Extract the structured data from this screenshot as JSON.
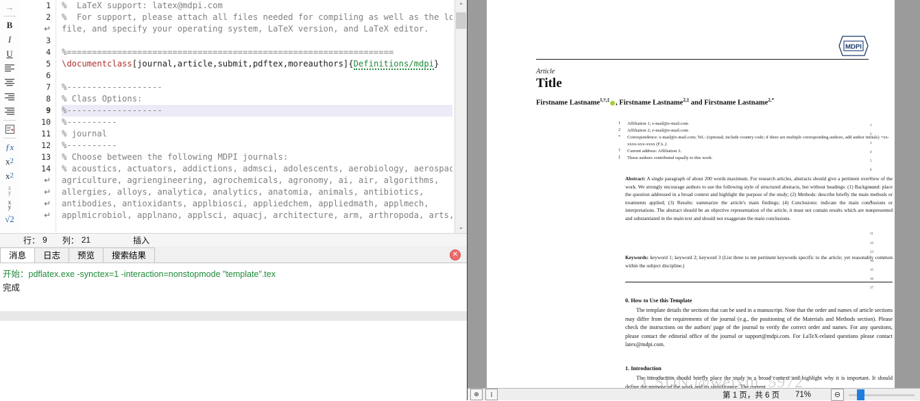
{
  "editor": {
    "format_toolbar": [
      {
        "name": "indent-arrow-icon",
        "glyph": "→"
      },
      {
        "name": "bold-icon",
        "glyph": "B"
      },
      {
        "name": "italic-icon",
        "glyph": "I"
      },
      {
        "name": "underline-icon",
        "glyph": "U"
      },
      {
        "name": "align-left-icon",
        "glyph": "≡"
      },
      {
        "name": "align-center-icon",
        "glyph": "≡"
      },
      {
        "name": "align-right-icon",
        "glyph": "≡"
      },
      {
        "name": "align-justify-icon",
        "glyph": "≡"
      },
      {
        "name": "insert-note-icon",
        "glyph": "▤"
      },
      {
        "name": "function-icon",
        "glyph": "ƒx"
      },
      {
        "name": "subscript-icon",
        "glyph": "x₂"
      },
      {
        "name": "superscript-icon",
        "glyph": "x²"
      },
      {
        "name": "inline-fraction-icon",
        "glyph": "x/y"
      },
      {
        "name": "display-fraction-icon",
        "glyph": "x/y"
      },
      {
        "name": "sqrt-icon",
        "glyph": "√2"
      }
    ],
    "gutter": [
      "1",
      "2",
      "↵",
      "3",
      "4",
      "5",
      "6",
      "7",
      "8",
      "9",
      "10",
      "11",
      "12",
      "13",
      "14",
      "↵",
      "↵",
      "↵",
      "↵"
    ],
    "current_line_index": 11,
    "lines": [
      {
        "gutter": "1",
        "text": "%  LaTeX support: latex@mdpi.com",
        "style": "comment"
      },
      {
        "gutter": "2",
        "text": "%  For support, please attach all files needed for compiling as well as the log",
        "style": "comment"
      },
      {
        "gutter": "↵",
        "text": "file, and specify your operating system, LaTeX version, and LaTeX editor.",
        "style": "comment"
      },
      {
        "gutter": "3",
        "text": "",
        "style": "comment"
      },
      {
        "gutter": "4",
        "text": "%=================================================================",
        "style": "comment"
      },
      {
        "gutter": "5",
        "text": "\\documentclass[journal,article,submit,pdftex,moreauthors]{Definitions/mdpi}",
        "style": "code"
      },
      {
        "gutter": "6",
        "text": "",
        "style": "comment"
      },
      {
        "gutter": "7",
        "text": "%-------------------",
        "style": "comment"
      },
      {
        "gutter": "8",
        "text": "% Class Options:",
        "style": "comment"
      },
      {
        "gutter": "9",
        "text": "%-------------------",
        "style": "comment",
        "highlight": true
      },
      {
        "gutter": "10",
        "text": "%----------",
        "style": "comment"
      },
      {
        "gutter": "11",
        "text": "% journal",
        "style": "comment"
      },
      {
        "gutter": "12",
        "text": "%----------",
        "style": "comment"
      },
      {
        "gutter": "13",
        "text": "% Choose between the following MDPI journals:",
        "style": "comment"
      },
      {
        "gutter": "14",
        "text": "% acoustics, actuators, addictions, admsci, adolescents, aerobiology, aerospace,",
        "style": "comment"
      },
      {
        "gutter": "↵",
        "text": "agriculture, agriengineering, agrochemicals, agronomy, ai, air, algorithms,",
        "style": "comment"
      },
      {
        "gutter": "↵",
        "text": "allergies, alloys, analytica, analytics, anatomia, animals, antibiotics,",
        "style": "comment"
      },
      {
        "gutter": "↵",
        "text": "antibodies, antioxidants, applbiosci, appliedchem, appliedmath, applmech,",
        "style": "comment"
      },
      {
        "gutter": "↵",
        "text": "applmicrobiol, applnano, applsci, aquacj, architecture, arm, arthropoda, arts,",
        "style": "comment"
      }
    ],
    "documentclass_line": {
      "command": "\\documentclass",
      "options": "[journal,article,submit,pdftex,moreauthors]{",
      "spellchecked": "Definitions/mdpi",
      "close": "}"
    },
    "status_bar": {
      "row_label": "行：",
      "row_value": "9",
      "col_label": "列：",
      "col_value": "21",
      "mode": "插入"
    },
    "scrollbar": {
      "up": "⌃",
      "down": "⌄"
    }
  },
  "output_panel": {
    "tabs": [
      {
        "label": "消息",
        "active": true
      },
      {
        "label": "日志",
        "active": false
      },
      {
        "label": "预览",
        "active": false
      },
      {
        "label": "搜索结果",
        "active": false
      }
    ],
    "close_icon": "✕",
    "messages": [
      {
        "text": "开始：pdflatex.exe -synctex=1 -interaction=nonstopmode \"template\".tex",
        "color": "green"
      },
      {
        "text": "完成",
        "color": "black"
      }
    ]
  },
  "pdf": {
    "logo_text": "MDPI",
    "article_label": "Article",
    "title": "Title",
    "authors_prefix": "Firstname Lastname",
    "authors_line_parts": [
      {
        "text": "Firstname Lastname",
        "sup": "1,†,‡",
        "orcid": true
      },
      {
        "text": ", Firstname Lastname",
        "sup": "2,‡",
        "orcid": false
      },
      {
        "text": " and Firstname Lastname",
        "sup": "2,*",
        "orcid": false
      }
    ],
    "affiliations": [
      {
        "mark": "1",
        "text": "Affiliation 1; e-mail@e-mail.com"
      },
      {
        "mark": "2",
        "text": "Affiliation 2; e-mail@e-mail.com"
      },
      {
        "mark": "*",
        "text": "Correspondence: e-mail@e-mail.com; Tel.: (optional; include country code; if there are multiple corresponding authors, add author initials) +xx-xxxx-xxx-xxxx (F.L.)"
      },
      {
        "mark": "†",
        "text": "Current address: Affiliation 3."
      },
      {
        "mark": "‡",
        "text": "These authors contributed equally to this work."
      }
    ],
    "abstract_label": "Abstract:",
    "abstract_text": " A single paragraph of about 200 words maximum. For research articles, abstracts should give a pertinent overview of the work. We strongly encourage authors to use the following style of structured abstracts, but without headings: (1) Background: place the question addressed in a broad context and highlight the purpose of the study; (2) Methods: describe briefly the main methods or treatments applied; (3) Results: summarize the article's main findings; (4) Conclusions: indicate the main conclusions or interpretations. The abstract should be an objective representation of the article, it must not contain results which are not presented and substantiated in the main text and should not exaggerate the main conclusions.",
    "keywords_label": "Keywords:",
    "keywords_text": " keyword 1; keyword 2; keyword 3 (List three to ten pertinent keywords specific to the article; yet reasonably common within the subject discipline.)",
    "section0_heading": "0. How to Use this Template",
    "section0_text": "The template details the sections that can be used in a manuscript. Note that the order and names of article sections may differ from the requirements of the journal (e.g., the positioning of the Materials and Methods section). Please check the instructions on the authors' page of the journal to verify the correct order and names. For any questions, please contact the editorial office of the journal or support@mdpi.com. For LaTeX-related questions please contact latex@mdpi.com.",
    "section1_heading": "1. Introduction",
    "section1_text": "The introduction should briefly place the study in a broad context and highlight why it is important. It should define the purpose of the work and its significance. The current",
    "line_numbers": [
      "1",
      "2",
      "3",
      "4",
      "5",
      "6",
      "7",
      "8",
      "9",
      "10",
      "11",
      "12",
      "13",
      "14",
      "15",
      "16",
      "17"
    ],
    "watermark": "CSDN @weixin_5972",
    "toolbar": {
      "fit-page-icon": "⊕",
      "text-select-icon": "I",
      "page_indicator": "第 1 页，共 6 页",
      "zoom_level": "71%",
      "zoom_out_icon": "⊖"
    }
  },
  "colors": {
    "comment": "#808080",
    "command": "#b03030",
    "spellcheck": "#1f8a3a",
    "highlight_line": "#eceaf7",
    "pdf_bg": "#9b9b9b",
    "accent": "#1f7de0"
  }
}
